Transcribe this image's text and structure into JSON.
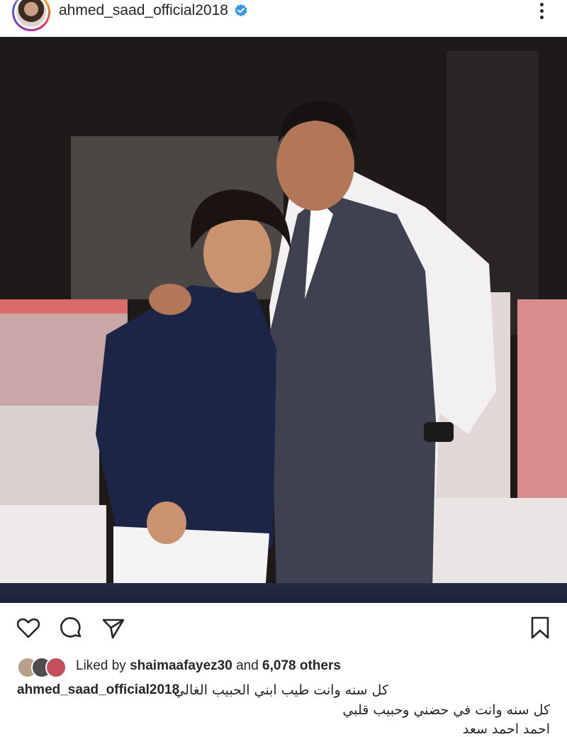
{
  "post": {
    "username": "ahmed_saad_official2018",
    "verified": true,
    "avatar_icon": "profile-avatar",
    "more_icon": "more-vertical-icon"
  },
  "photo": {
    "colors": {
      "background": "#1e1b1b",
      "band": "#1b2037"
    }
  },
  "actions": {
    "icons": [
      "heart-icon",
      "comment-icon",
      "share-icon",
      "bookmark-icon"
    ]
  },
  "likes": {
    "prefix": "Liked by",
    "liker": "shaimaafayez30",
    "conjunction": "and",
    "others": "6,078 others"
  },
  "caption": {
    "username": "ahmed_saad_official2018",
    "lines": [
      "كل سنه وانت طيب ابني الحبيب الغالي",
      "كل سنه وانت في حضني وحبيب قلبي",
      "احمد احمد سعد"
    ]
  },
  "colors": {
    "text": "#262626",
    "verified": "#3897f0"
  }
}
